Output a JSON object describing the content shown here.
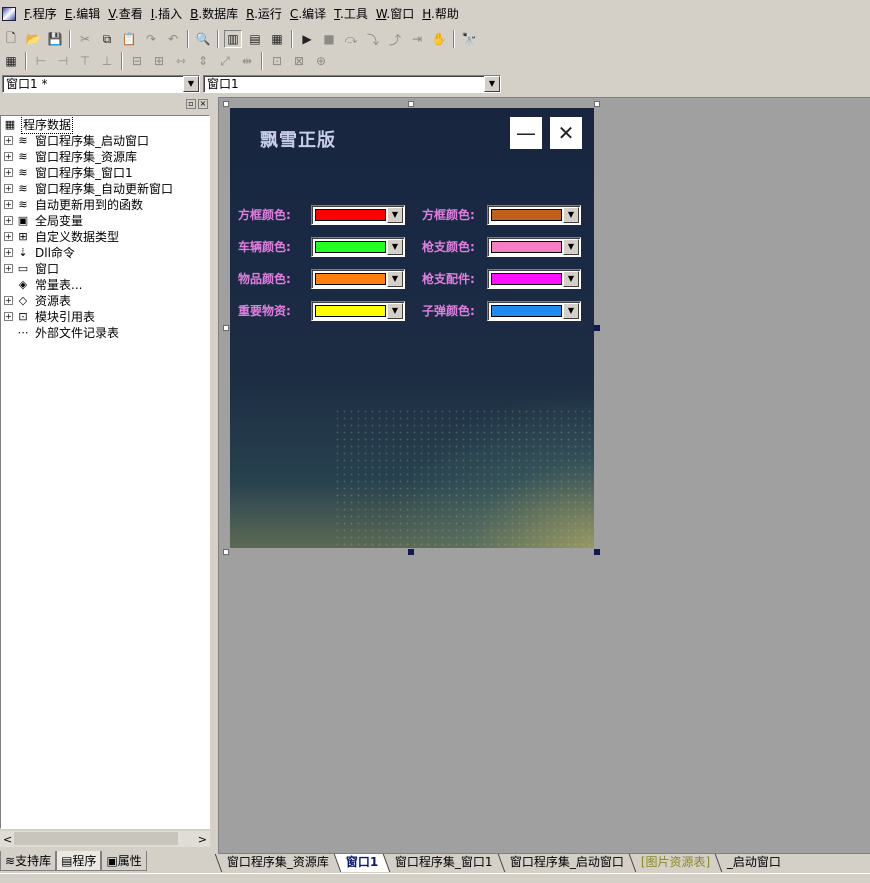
{
  "menu": [
    {
      "key": "F",
      "label": ".程序"
    },
    {
      "key": "E",
      "label": ".编辑"
    },
    {
      "key": "V",
      "label": ".查看"
    },
    {
      "key": "I",
      "label": ".插入"
    },
    {
      "key": "B",
      "label": ".数据库"
    },
    {
      "key": "R",
      "label": ".运行"
    },
    {
      "key": "C",
      "label": ".编译"
    },
    {
      "key": "T",
      "label": ".工具"
    },
    {
      "key": "W",
      "label": ".窗口"
    },
    {
      "key": "H",
      "label": ".帮助"
    }
  ],
  "combos": {
    "left": "窗口1 *",
    "right": "窗口1"
  },
  "tree": [
    {
      "label": "程序数据",
      "icon": "root",
      "exp": ""
    },
    {
      "label": "窗口程序集_启动窗口",
      "icon": "stack",
      "exp": "+"
    },
    {
      "label": "窗口程序集_资源库",
      "icon": "stack",
      "exp": "+"
    },
    {
      "label": "窗口程序集_窗口1",
      "icon": "stack",
      "exp": "+"
    },
    {
      "label": "窗口程序集_自动更新窗口",
      "icon": "stack",
      "exp": "+"
    },
    {
      "label": "自动更新用到的函数",
      "icon": "stack",
      "exp": "+"
    },
    {
      "label": "全局变量",
      "icon": "var",
      "exp": "+"
    },
    {
      "label": "自定义数据类型",
      "icon": "type",
      "exp": "+"
    },
    {
      "label": "Dll命令",
      "icon": "dll",
      "exp": "+"
    },
    {
      "label": "窗口",
      "icon": "window",
      "exp": "+"
    },
    {
      "label": "常量表...",
      "icon": "const",
      "exp": ""
    },
    {
      "label": "资源表",
      "icon": "res",
      "exp": "+"
    },
    {
      "label": "模块引用表",
      "icon": "module",
      "exp": "+"
    },
    {
      "label": "外部文件记录表",
      "icon": "file",
      "exp": ""
    }
  ],
  "left_tabs": [
    "支持库",
    "程序",
    "属性"
  ],
  "form": {
    "title": "飘雪正版",
    "minimize": "—",
    "close": "✕",
    "rows": [
      {
        "l_label": "方框颜色:",
        "l_color": "#ff0000",
        "r_label": "方框颜色:",
        "r_color": "#c0601a"
      },
      {
        "l_label": "车辆颜色:",
        "l_color": "#22ff22",
        "r_label": "枪支颜色:",
        "r_color": "#f77ec2"
      },
      {
        "l_label": "物品颜色:",
        "l_color": "#ff7f0e",
        "r_label": "枪支配件:",
        "r_color": "#ff10ff"
      },
      {
        "l_label": "重要物资:",
        "l_color": "#ffff00",
        "r_label": "子弹颜色:",
        "r_color": "#1f8af0"
      }
    ]
  },
  "bottom_tabs": [
    {
      "label": "窗口程序集_资源库",
      "state": "normal"
    },
    {
      "label": "窗口1",
      "state": "active"
    },
    {
      "label": "窗口程序集_窗口1",
      "state": "normal"
    },
    {
      "label": "窗口程序集_启动窗口",
      "state": "normal"
    },
    {
      "label": "[图片资源表]",
      "state": "yellow"
    },
    {
      "label": "_启动窗口",
      "state": "normal"
    }
  ]
}
